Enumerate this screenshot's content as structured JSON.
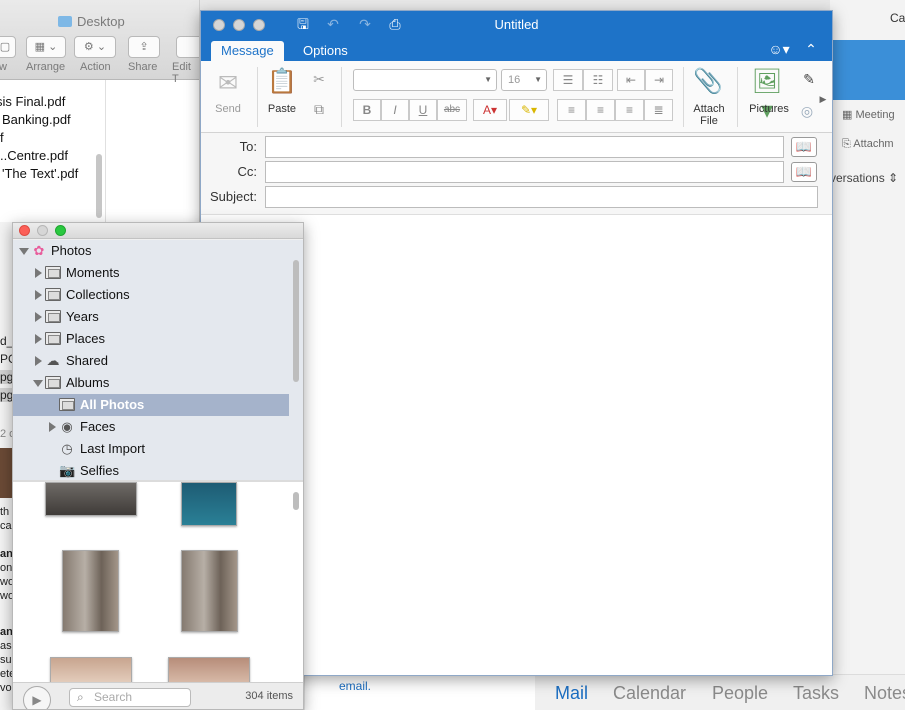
{
  "finder": {
    "title": "Desktop",
    "toolbar": [
      "Arrange",
      "Action",
      "Share",
      "Edit T"
    ],
    "files": [
      "sis Final.pdf",
      "Banking.pdf",
      "f",
      "..Centre.pdf",
      "'The Text'.pdf"
    ]
  },
  "left_fragments": [
    "d_",
    "PG",
    "pg",
    "pg",
    "2 o",
    "th",
    "cal",
    "and",
    "ont",
    "wo",
    "wo",
    "and",
    "as",
    "su",
    "ete",
    "vo"
  ],
  "outlook_bg": {
    "top_right": "Ca",
    "items": [
      "Meeting",
      "Attachm",
      "versations"
    ],
    "note_text": "email.",
    "nav": [
      "Mail",
      "Calendar",
      "People",
      "Tasks",
      "Notes"
    ]
  },
  "compose": {
    "title": "Untitled",
    "tabs": [
      "Message",
      "Options"
    ],
    "ribbon": {
      "send": "Send",
      "paste": "Paste",
      "font_name": "",
      "font_size": "16",
      "attach_line1": "Attach",
      "attach_line2": "File",
      "pictures": "Pictures"
    },
    "fields": {
      "to_label": "To:",
      "cc_label": "Cc:",
      "subject_label": "Subject:",
      "to_value": "",
      "cc_value": "",
      "subject_value": ""
    }
  },
  "photos": {
    "tree": [
      {
        "label": "Photos",
        "depth": 0
      },
      {
        "label": "Moments",
        "depth": 1
      },
      {
        "label": "Collections",
        "depth": 1
      },
      {
        "label": "Years",
        "depth": 1
      },
      {
        "label": "Places",
        "depth": 1
      },
      {
        "label": "Shared",
        "depth": 1
      },
      {
        "label": "Albums",
        "depth": 1
      },
      {
        "label": "All Photos",
        "depth": 2
      },
      {
        "label": "Faces",
        "depth": 2
      },
      {
        "label": "Last Import",
        "depth": 2
      },
      {
        "label": "Selfies",
        "depth": 2
      }
    ],
    "search_placeholder": "Search",
    "count": "304 items"
  },
  "colors": {
    "outlook_blue": "#1e73c8",
    "selection": "#a5b3cb"
  }
}
